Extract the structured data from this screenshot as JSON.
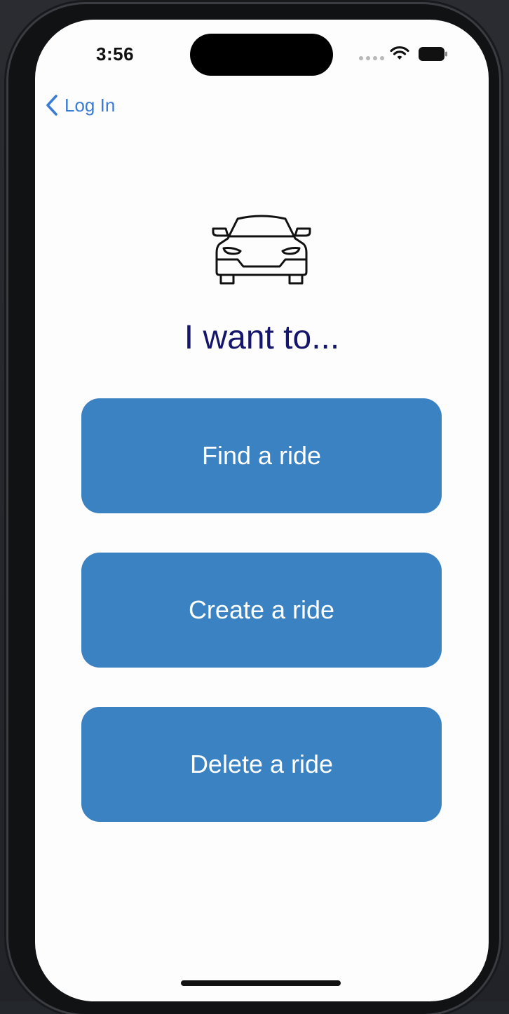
{
  "status_bar": {
    "time": "3:56",
    "wifi_icon": "wifi-icon",
    "battery_icon": "battery-icon"
  },
  "nav": {
    "back_label": "Log In",
    "back_icon": "chevron-left-icon"
  },
  "main": {
    "icon": "car-icon",
    "heading": "I want to...",
    "buttons": [
      {
        "label": "Find a ride"
      },
      {
        "label": "Create a ride"
      },
      {
        "label": "Delete a ride"
      }
    ]
  },
  "colors": {
    "accent_blue": "#3b82c2",
    "heading_navy": "#15166b",
    "link_blue": "#3a7bd5",
    "background": "#fdfdfd"
  }
}
